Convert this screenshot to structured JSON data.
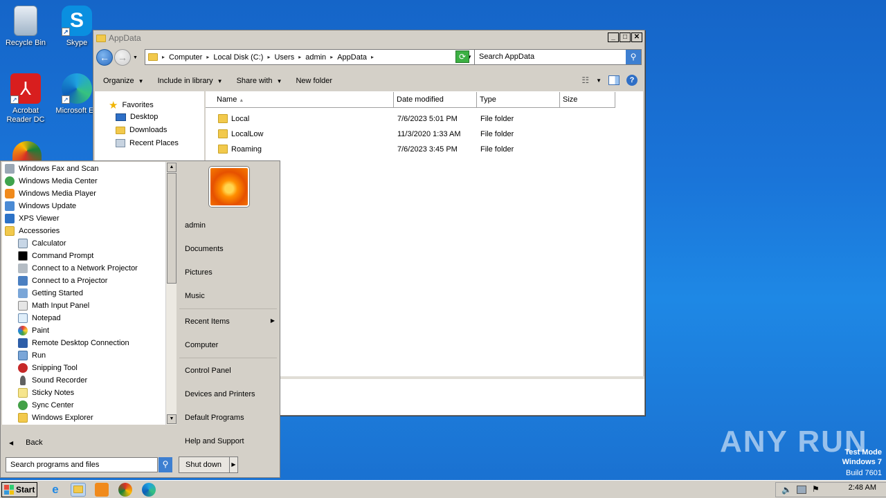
{
  "desktop": {
    "icons": [
      {
        "label": "Recycle Bin"
      },
      {
        "label": "Skype"
      },
      {
        "label": "Acrobat Reader DC"
      },
      {
        "label": "Microsoft Ed"
      }
    ],
    "watermark": "ANY RUN",
    "test_mode": {
      "line1": "Test Mode",
      "line2": "Windows 7",
      "line3": "Build 7601"
    }
  },
  "explorer": {
    "title": "AppData",
    "breadcrumb": [
      "Computer",
      "Local Disk (C:)",
      "Users",
      "admin",
      "AppData"
    ],
    "search_placeholder": "Search AppData",
    "toolbar": {
      "organize": "Organize",
      "include": "Include in library",
      "share": "Share with",
      "new_folder": "New folder"
    },
    "nav": {
      "favorites": "Favorites",
      "items": [
        "Desktop",
        "Downloads",
        "Recent Places"
      ]
    },
    "columns": {
      "name": "Name",
      "date": "Date modified",
      "type": "Type",
      "size": "Size"
    },
    "rows": [
      {
        "name": "Local",
        "date": "7/6/2023 5:01 PM",
        "type": "File folder"
      },
      {
        "name": "LocalLow",
        "date": "11/3/2020 1:33 AM",
        "type": "File folder"
      },
      {
        "name": "Roaming",
        "date": "7/6/2023 3:45 PM",
        "type": "File folder"
      }
    ]
  },
  "startmenu": {
    "programs": [
      "Windows Fax and Scan",
      "Windows Media Center",
      "Windows Media Player",
      "Windows Update",
      "XPS Viewer",
      "Accessories",
      "Calculator",
      "Command Prompt",
      "Connect to a Network Projector",
      "Connect to a Projector",
      "Getting Started",
      "Math Input Panel",
      "Notepad",
      "Paint",
      "Remote Desktop Connection",
      "Run",
      "Snipping Tool",
      "Sound Recorder",
      "Sticky Notes",
      "Sync Center",
      "Windows Explorer"
    ],
    "back": "Back",
    "search_placeholder": "Search programs and files",
    "right": {
      "user": "admin",
      "documents": "Documents",
      "pictures": "Pictures",
      "music": "Music",
      "recent": "Recent Items",
      "computer": "Computer",
      "control_panel": "Control Panel",
      "devices": "Devices and Printers",
      "defaults": "Default Programs",
      "help": "Help and Support"
    },
    "shutdown": "Shut down"
  },
  "taskbar": {
    "start": "Start",
    "clock": "2:48 AM"
  }
}
